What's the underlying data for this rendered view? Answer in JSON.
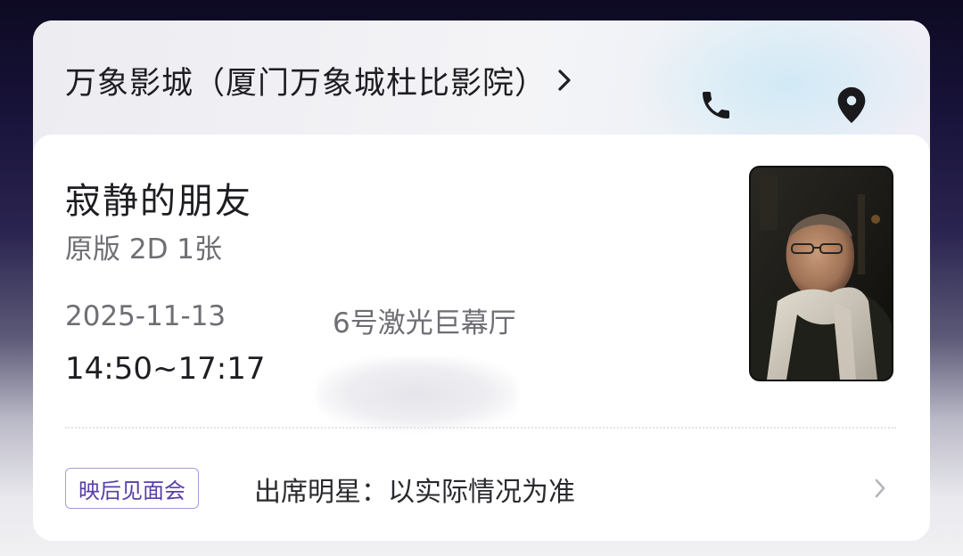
{
  "cinema": {
    "name": "万象影城（厦门万象城杜比影院）",
    "phone_icon": "phone-icon",
    "location_icon": "location-pin-icon"
  },
  "ticket": {
    "movie_title": "寂静的朋友",
    "info": "原版 2D 1张",
    "date": "2025-11-13",
    "hall": "6号激光巨幕厅",
    "time": "14:50~17:17"
  },
  "meet_event": {
    "badge": "映后见面会",
    "guests": "出席明星：以实际情况为准"
  },
  "colors": {
    "badge_text": "#5a3ea8",
    "badge_border": "#a79cd6",
    "primary_text": "#1e1e22",
    "secondary_text": "#6e6e74"
  }
}
